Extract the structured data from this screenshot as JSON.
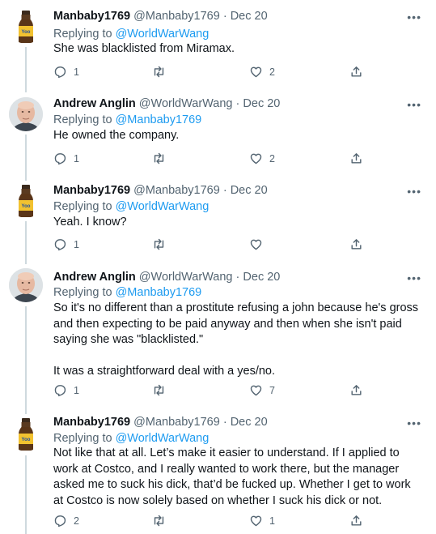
{
  "tweets": [
    {
      "avatar": "beverage-bottle",
      "name": "Manbaby1769",
      "handle": "@Manbaby1769",
      "date": "Dec 20",
      "replying_prefix": "Replying to",
      "replying_to": "@WorldWarWang",
      "text": [
        "She was blacklisted from Miramax."
      ],
      "replies": "1",
      "retweets": "",
      "likes": "2"
    },
    {
      "avatar": "bald-man",
      "name": "Andrew Anglin",
      "handle": "@WorldWarWang",
      "date": "Dec 20",
      "replying_prefix": "Replying to",
      "replying_to": "@Manbaby1769",
      "text": [
        "He owned the company."
      ],
      "replies": "1",
      "retweets": "",
      "likes": "2"
    },
    {
      "avatar": "beverage-bottle",
      "name": "Manbaby1769",
      "handle": "@Manbaby1769",
      "date": "Dec 20",
      "replying_prefix": "Replying to",
      "replying_to": "@WorldWarWang",
      "text": [
        "Yeah. I know?"
      ],
      "replies": "1",
      "retweets": "",
      "likes": ""
    },
    {
      "avatar": "bald-man",
      "name": "Andrew Anglin",
      "handle": "@WorldWarWang",
      "date": "Dec 20",
      "replying_prefix": "Replying to",
      "replying_to": "@Manbaby1769",
      "text": [
        "So it's no different than a prostitute refusing a john because he's gross and then expecting to be paid anyway and then when she isn't paid saying she was \"blacklisted.\"",
        "It was a straightforward deal with a yes/no."
      ],
      "replies": "1",
      "retweets": "",
      "likes": "7"
    },
    {
      "avatar": "beverage-bottle",
      "name": "Manbaby1769",
      "handle": "@Manbaby1769",
      "date": "Dec 20",
      "replying_prefix": "Replying to",
      "replying_to": "@WorldWarWang",
      "text": [
        "Not like that at all. Let’s make it easier to understand. If I applied to work at Costco, and I really wanted to work there, but the manager asked me to suck his dick, that’d be fucked up. Whether I get to work at Costco is now solely based on whether I suck his dick or not."
      ],
      "replies": "2",
      "retweets": "",
      "likes": "1"
    }
  ]
}
